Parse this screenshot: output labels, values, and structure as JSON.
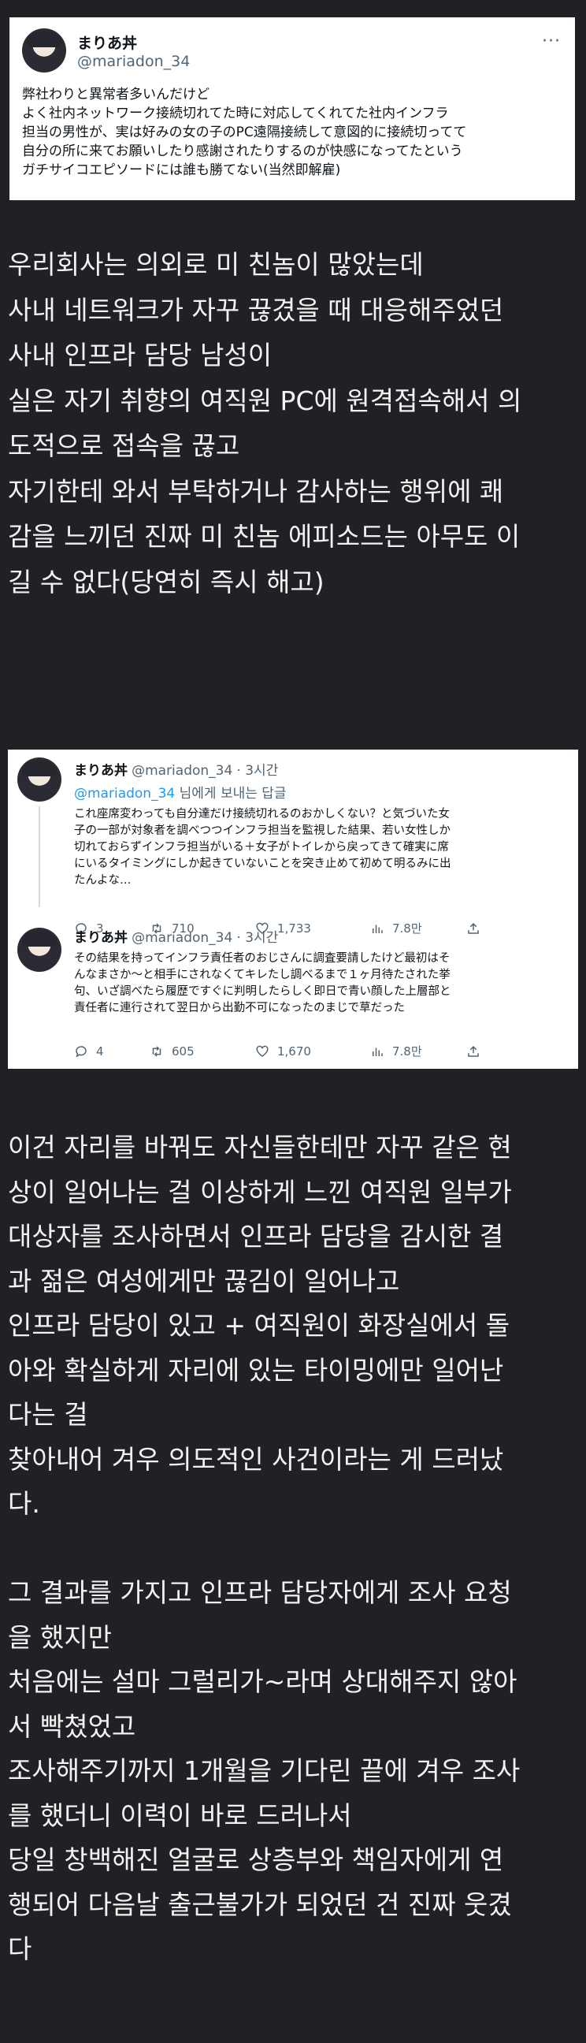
{
  "tweet1": {
    "name": "まりあ丼",
    "handle": "@mariadon_34",
    "lines": [
      "弊社わりと異常者多いんだけど",
      "よく社内ネットワーク接続切れてた時に対応してくれてた社内インフラ",
      "担当の男性が、実は好みの女の子のPC遠隔接続して意図的に接続切ってて",
      "自分の所に来てお願いしたり感謝されたりするのが快感になってたという",
      "ガチサイコエピソードには誰も勝てない(当然即解雇)"
    ]
  },
  "translation1": {
    "lines": [
      "우리회사는 의외로 미 친놈이 많았는데",
      "사내 네트워크가 자꾸 끊겼을 때 대응해주었던",
      "사내 인프라 담당 남성이",
      "실은 자기 취향의 여직원 PC에 원격접속해서 의",
      "도적으로 접속을 끊고",
      "자기한테 와서 부탁하거나 감사하는 행위에 쾌",
      "감을 느끼던 진짜 미 친놈 에피소드는 아무도 이",
      "길 수 없다(당연히 즉시 해고)"
    ]
  },
  "replies": [
    {
      "name": "まりあ丼",
      "handle": "@mariadon_34",
      "time": "· 3시간",
      "replying_mention": "@mariadon_34",
      "replying_suffix": " 님에게 보내는 답글",
      "lines": [
        "これ座席変わっても自分達だけ接続切れるのおかしくない？と気づいた女",
        "子の一部が対象者を調べつつインフラ担当を監視した結果、若い女性しか",
        "切れておらずインフラ担当がいる＋女子がトイレから戻ってきて確実に席",
        "にいるタイミングにしか起きていないことを突き止めて初めて明るみに出",
        "たんよな…"
      ],
      "stats": {
        "replies": "3",
        "retweets": "710",
        "likes": "1,733",
        "views": "7.8만"
      }
    },
    {
      "name": "まりあ丼",
      "handle": "@mariadon_34",
      "time": "· 3시간",
      "lines": [
        "その結果を持ってインフラ責任者のおじさんに調査要請したけど最初はそ",
        "んなまさか〜と相手にされなくてキレたし調べるまで１ヶ月待たされた挙",
        "句、いざ調べたら履歴ですぐに判明したらしく即日で青い顔した上層部と",
        "責任者に連行されて翌日から出勤不可になったのまじで草だった"
      ],
      "stats": {
        "replies": "4",
        "retweets": "605",
        "likes": "1,670",
        "views": "7.8만"
      }
    }
  ],
  "translation2": {
    "lines": [
      "이건 자리를 바꿔도 자신들한테만 자꾸 같은 현",
      "상이 일어나는 걸 이상하게 느낀 여직원 일부가",
      "대상자를 조사하면서 인프라 담당을 감시한 결",
      "과 젊은 여성에게만 끊김이 일어나고",
      "인프라 담당이 있고 + 여직원이 화장실에서 돌",
      "아와 확실하게 자리에 있는 타이밍에만 일어난",
      "다는 걸",
      "찾아내어 겨우 의도적인 사건이라는 게 드러났",
      "다.",
      "",
      "그 결과를 가지고 인프라 담당자에게 조사 요청",
      "을 했지만",
      "처음에는 설마 그럴리가~라며 상대해주지 않아",
      "서 빡쳤었고",
      "조사해주기까지 1개월을 기다린 끝에 겨우 조사",
      "를 했더니 이력이 바로 드러나서",
      "당일 창백해진 얼굴로 상층부와 책임자에게 연",
      "행되어 다음날 출근불가가 되었던 건 진짜 웃겼",
      "다"
    ]
  }
}
